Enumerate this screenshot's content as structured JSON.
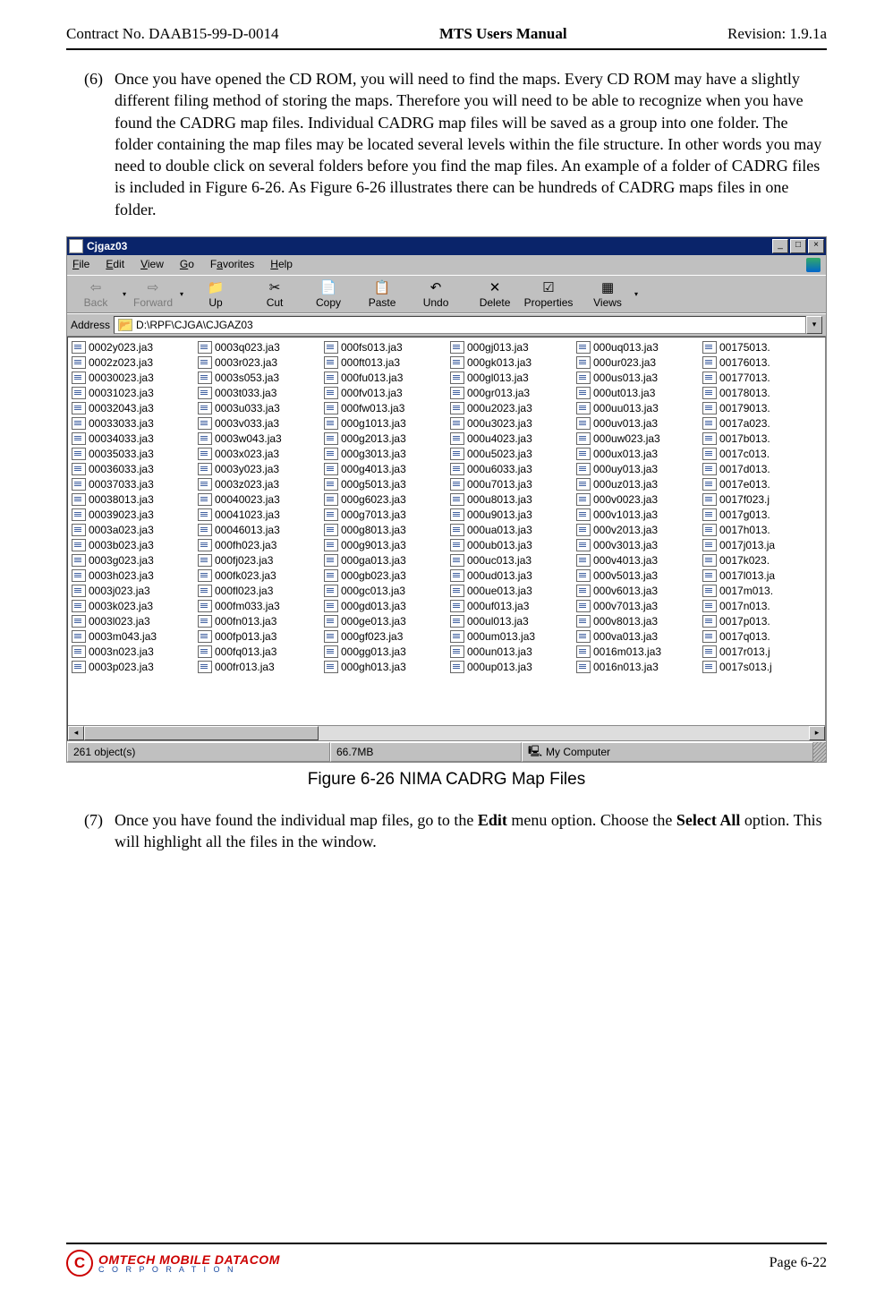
{
  "header": {
    "left": "Contract No. DAAB15-99-D-0014",
    "mid": "MTS Users Manual",
    "right": "Revision:  1.9.1a"
  },
  "para6": {
    "num": "(6)",
    "text": "Once you have opened the CD ROM, you will need to find the maps. Every CD ROM may have a slightly different filing method of storing the maps.  Therefore you will need to be able to recognize when you have found the CADRG map files.  Individual CADRG map files will be saved as a group into one folder.   The folder containing the map files may be located several levels within the file structure.  In other words you may need to double click on several folders before you find the map files.  An example of a folder of CADRG files is included in Figure 6-26.  As Figure 6-26 illustrates there can be hundreds of CADRG maps files in one folder."
  },
  "fig": {
    "title": "Cjgaz03",
    "menu": {
      "file": "File",
      "edit": "Edit",
      "view": "View",
      "go": "Go",
      "fav": "Favorites",
      "help": "Help"
    },
    "tb": {
      "back": "Back",
      "forward": "Forward",
      "up": "Up",
      "cut": "Cut",
      "copy": "Copy",
      "paste": "Paste",
      "undo": "Undo",
      "delete": "Delete",
      "properties": "Properties",
      "views": "Views"
    },
    "addrLabel": "Address",
    "addrPath": "D:\\RPF\\CJGA\\CJGAZ03",
    "cols": [
      [
        "0002y023.ja3",
        "0002z023.ja3",
        "00030023.ja3",
        "00031023.ja3",
        "00032043.ja3",
        "00033033.ja3",
        "00034033.ja3",
        "00035033.ja3",
        "00036033.ja3",
        "00037033.ja3",
        "00038013.ja3",
        "00039023.ja3",
        "0003a023.ja3",
        "0003b023.ja3",
        "0003g023.ja3",
        "0003h023.ja3",
        "0003j023.ja3",
        "0003k023.ja3",
        "0003l023.ja3",
        "0003m043.ja3",
        "0003n023.ja3",
        "0003p023.ja3"
      ],
      [
        "0003q023.ja3",
        "0003r023.ja3",
        "0003s053.ja3",
        "0003t033.ja3",
        "0003u033.ja3",
        "0003v033.ja3",
        "0003w043.ja3",
        "0003x023.ja3",
        "0003y023.ja3",
        "0003z023.ja3",
        "00040023.ja3",
        "00041023.ja3",
        "00046013.ja3",
        "000fh023.ja3",
        "000fj023.ja3",
        "000fk023.ja3",
        "000fl023.ja3",
        "000fm033.ja3",
        "000fn013.ja3",
        "000fp013.ja3",
        "000fq013.ja3",
        "000fr013.ja3"
      ],
      [
        "000fs013.ja3",
        "000ft013.ja3",
        "000fu013.ja3",
        "000fv013.ja3",
        "000fw013.ja3",
        "000g1013.ja3",
        "000g2013.ja3",
        "000g3013.ja3",
        "000g4013.ja3",
        "000g5013.ja3",
        "000g6023.ja3",
        "000g7013.ja3",
        "000g8013.ja3",
        "000g9013.ja3",
        "000ga013.ja3",
        "000gb023.ja3",
        "000gc013.ja3",
        "000gd013.ja3",
        "000ge013.ja3",
        "000gf023.ja3",
        "000gg013.ja3",
        "000gh013.ja3"
      ],
      [
        "000gj013.ja3",
        "000gk013.ja3",
        "000gl013.ja3",
        "000gr013.ja3",
        "000u2023.ja3",
        "000u3023.ja3",
        "000u4023.ja3",
        "000u5023.ja3",
        "000u6033.ja3",
        "000u7013.ja3",
        "000u8013.ja3",
        "000u9013.ja3",
        "000ua013.ja3",
        "000ub013.ja3",
        "000uc013.ja3",
        "000ud013.ja3",
        "000ue013.ja3",
        "000uf013.ja3",
        "000ul013.ja3",
        "000um013.ja3",
        "000un013.ja3",
        "000up013.ja3"
      ],
      [
        "000uq013.ja3",
        "000ur023.ja3",
        "000us013.ja3",
        "000ut013.ja3",
        "000uu013.ja3",
        "000uv013.ja3",
        "000uw023.ja3",
        "000ux013.ja3",
        "000uy013.ja3",
        "000uz013.ja3",
        "000v0023.ja3",
        "000v1013.ja3",
        "000v2013.ja3",
        "000v3013.ja3",
        "000v4013.ja3",
        "000v5013.ja3",
        "000v6013.ja3",
        "000v7013.ja3",
        "000v8013.ja3",
        "000va013.ja3",
        "0016m013.ja3",
        "0016n013.ja3"
      ],
      [
        "00175013.",
        "00176013.",
        "00177013.",
        "00178013.",
        "00179013.",
        "0017a023.",
        "0017b013.",
        "0017c013.",
        "0017d013.",
        "0017e013.",
        "0017f023.j",
        "0017g013.",
        "0017h013.",
        "0017j013.ja",
        "0017k023.",
        "0017l013.ja",
        "0017m013.",
        "0017n013.",
        "0017p013.",
        "0017q013.",
        "0017r013.j",
        "0017s013.j"
      ]
    ],
    "status": {
      "objects": "261 object(s)",
      "size": "66.7MB",
      "loc": "My Computer"
    }
  },
  "caption": "Figure 6-26   NIMA CADRG Map Files",
  "para7": {
    "num": "(7)",
    "t1": "Once you have found the individual map files, go to the ",
    "b1": "Edit",
    "t2": " menu option.  Choose the ",
    "b2": "Select All",
    "t3": " option.  This will highlight all the files in the window."
  },
  "footer": {
    "brand1": "MOBILE DATACOM",
    "brand2": "C O R P O R A T I O N",
    "page": "Page 6-22"
  }
}
